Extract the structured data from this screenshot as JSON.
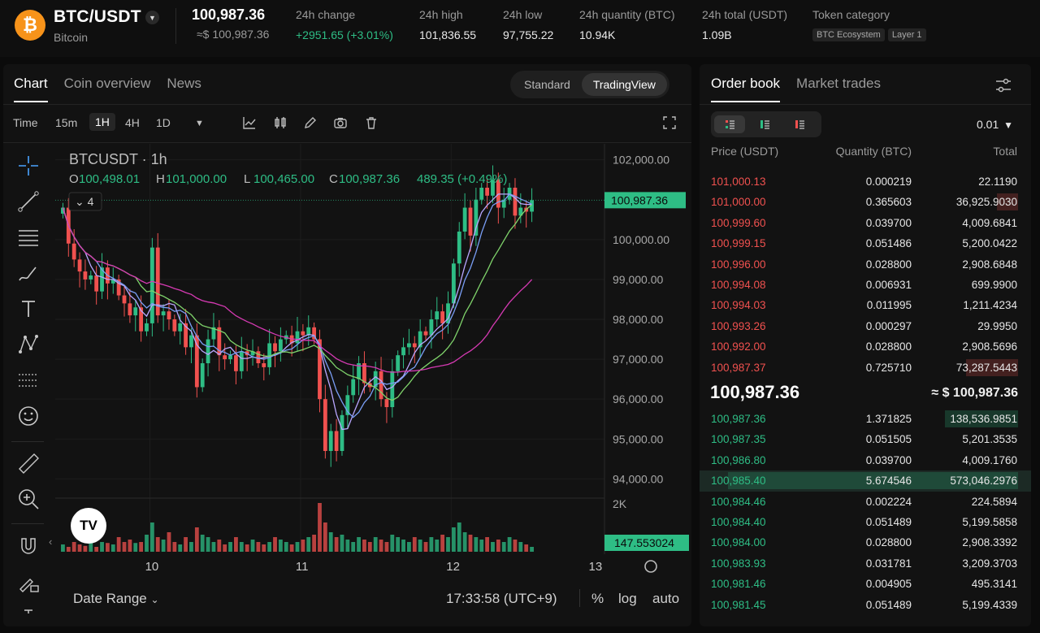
{
  "header": {
    "pair": "BTC/USDT",
    "coin_name": "Bitcoin",
    "coin_symbol_glyph": "₿",
    "last_price": "100,987.36",
    "last_price_usd": "≈$ 100,987.36",
    "stats": [
      {
        "label": "24h change",
        "value": "+2951.65 (+3.01%)",
        "color": "#2ebd85"
      },
      {
        "label": "24h high",
        "value": "101,836.55"
      },
      {
        "label": "24h low",
        "value": "97,755.22"
      },
      {
        "label": "24h quantity (BTC)",
        "value": "10.94K"
      },
      {
        "label": "24h total (USDT)",
        "value": "1.09B"
      }
    ],
    "token_category": {
      "label": "Token category",
      "tags": [
        "BTC Ecosystem",
        "Layer 1"
      ]
    }
  },
  "chart_panel": {
    "tabs": [
      "Chart",
      "Coin overview",
      "News"
    ],
    "active_tab": "Chart",
    "view_modes": [
      "Standard",
      "TradingView"
    ],
    "active_view": "TradingView",
    "time_label": "Time",
    "intervals": [
      "15m",
      "1H",
      "4H",
      "1D"
    ],
    "active_interval": "1H",
    "footer": {
      "date_range": "Date Range",
      "clock": "17:33:58 (UTC+9)",
      "options": [
        "%",
        "log",
        "auto"
      ]
    },
    "tv_logo_text": "TV"
  },
  "chart_data": {
    "type": "candlestick",
    "symbol_title": "BTCUSDT · 1h",
    "ohlc_legend": {
      "o": "100,498.01",
      "h": "101,000.00",
      "l": "100,465.00",
      "c": "100,987.36",
      "change": "489.35 (+0.49%)"
    },
    "indicator_count": "4",
    "y_ticks": [
      "102,000.00",
      "100,000.00",
      "99,000.00",
      "98,000.00",
      "97,000.00",
      "96,000.00",
      "95,000.00",
      "94,000.00"
    ],
    "y_tick_values": [
      102000,
      100000,
      99000,
      98000,
      97000,
      96000,
      95000,
      94000
    ],
    "x_ticks": [
      "10",
      "11",
      "12",
      "13"
    ],
    "last_price_label": "100,987.36",
    "last_price_value": 100987.36,
    "volume_axis_label": "2K",
    "volume_last_label": "147.553024",
    "colors": {
      "up": "#2ebd85",
      "down": "#f0514f",
      "ma1": "#b9a7ff",
      "ma2": "#7a9ef5",
      "ma3": "#7fd36b",
      "ma4": "#d63ab3"
    },
    "closes": [
      100800,
      99900,
      99500,
      99200,
      99000,
      99100,
      98700,
      99300,
      98900,
      99000,
      98600,
      98400,
      98100,
      98300,
      97700,
      97900,
      99800,
      98100,
      98200,
      98000,
      97700,
      97900,
      97300,
      97600,
      96300,
      96900,
      97500,
      97800,
      97100,
      97000,
      97100,
      96700,
      97200,
      97100,
      97200,
      96900,
      96800,
      97400,
      97200,
      97500,
      97600,
      97400,
      97700,
      97600,
      97800,
      97500,
      96000,
      94700,
      95200,
      94700,
      95600,
      96100,
      96500,
      96900,
      96400,
      96300,
      96700,
      96000,
      95800,
      96700,
      97100,
      97300,
      97400,
      97300,
      97700,
      97600,
      98000,
      98200,
      97900,
      98400,
      99400,
      100200,
      100800,
      100100,
      101000,
      101300,
      101100,
      101500,
      100800,
      101000,
      101300,
      100600,
      100800,
      100700,
      100987
    ],
    "volumes": [
      0.15,
      0.1,
      0.2,
      0.15,
      0.12,
      0.25,
      0.1,
      0.2,
      0.18,
      0.15,
      0.3,
      0.2,
      0.25,
      0.18,
      0.2,
      0.35,
      0.6,
      0.3,
      0.25,
      0.4,
      0.2,
      0.15,
      0.3,
      0.2,
      0.5,
      0.35,
      0.3,
      0.2,
      0.25,
      0.15,
      0.2,
      0.3,
      0.2,
      0.15,
      0.25,
      0.2,
      0.15,
      0.2,
      0.3,
      0.25,
      0.2,
      0.15,
      0.2,
      0.25,
      0.3,
      0.35,
      1.0,
      0.6,
      0.4,
      0.3,
      0.35,
      0.25,
      0.2,
      0.3,
      0.25,
      0.2,
      0.3,
      0.25,
      0.2,
      0.35,
      0.3,
      0.25,
      0.2,
      0.3,
      0.25,
      0.2,
      0.3,
      0.25,
      0.35,
      0.3,
      0.5,
      0.6,
      0.4,
      0.35,
      0.3,
      0.25,
      0.3,
      0.2,
      0.25,
      0.2,
      0.3,
      0.25,
      0.2,
      0.15,
      0.1
    ]
  },
  "order_book": {
    "tabs": [
      "Order book",
      "Market trades"
    ],
    "active_tab": "Order book",
    "step": "0.01",
    "columns": [
      "Price (USDT)",
      "Quantity (BTC)",
      "Total"
    ],
    "asks": [
      {
        "price": "101,000.13",
        "qty": "0.000219",
        "total": "22.1190",
        "depth": 0.0
      },
      {
        "price": "101,000.00",
        "qty": "0.365603",
        "total": "36,925.9030",
        "depth": 0.07
      },
      {
        "price": "100,999.60",
        "qty": "0.039700",
        "total": "4,009.6841",
        "depth": 0.0
      },
      {
        "price": "100,999.15",
        "qty": "0.051486",
        "total": "5,200.0422",
        "depth": 0.0
      },
      {
        "price": "100,996.00",
        "qty": "0.028800",
        "total": "2,908.6848",
        "depth": 0.0
      },
      {
        "price": "100,994.08",
        "qty": "0.006931",
        "total": "699.9900",
        "depth": 0.0
      },
      {
        "price": "100,994.03",
        "qty": "0.011995",
        "total": "1,211.4234",
        "depth": 0.0
      },
      {
        "price": "100,993.26",
        "qty": "0.000297",
        "total": "29.9950",
        "depth": 0.0
      },
      {
        "price": "100,992.00",
        "qty": "0.028800",
        "total": "2,908.5696",
        "depth": 0.0
      },
      {
        "price": "100,987.37",
        "qty": "0.725710",
        "total": "73,287.5443",
        "depth": 0.17
      }
    ],
    "mid_price": "100,987.36",
    "mid_price_usd": "≈ $ 100,987.36",
    "bids": [
      {
        "price": "100,987.36",
        "qty": "1.371825",
        "total": "138,536.9851",
        "depth": 0.24
      },
      {
        "price": "100,987.35",
        "qty": "0.051505",
        "total": "5,201.3535",
        "depth": 0.0
      },
      {
        "price": "100,986.80",
        "qty": "0.039700",
        "total": "4,009.1760",
        "depth": 0.0
      },
      {
        "price": "100,985.40",
        "qty": "5.674546",
        "total": "573,046.2976",
        "depth": 0.95
      },
      {
        "price": "100,984.46",
        "qty": "0.002224",
        "total": "224.5894",
        "depth": 0.0
      },
      {
        "price": "100,984.40",
        "qty": "0.051489",
        "total": "5,199.5858",
        "depth": 0.0
      },
      {
        "price": "100,984.00",
        "qty": "0.028800",
        "total": "2,908.3392",
        "depth": 0.0
      },
      {
        "price": "100,983.93",
        "qty": "0.031781",
        "total": "3,209.3703",
        "depth": 0.0
      },
      {
        "price": "100,981.46",
        "qty": "0.004905",
        "total": "495.3141",
        "depth": 0.0
      },
      {
        "price": "100,981.45",
        "qty": "0.051489",
        "total": "5,199.4339",
        "depth": 0.0
      }
    ]
  }
}
